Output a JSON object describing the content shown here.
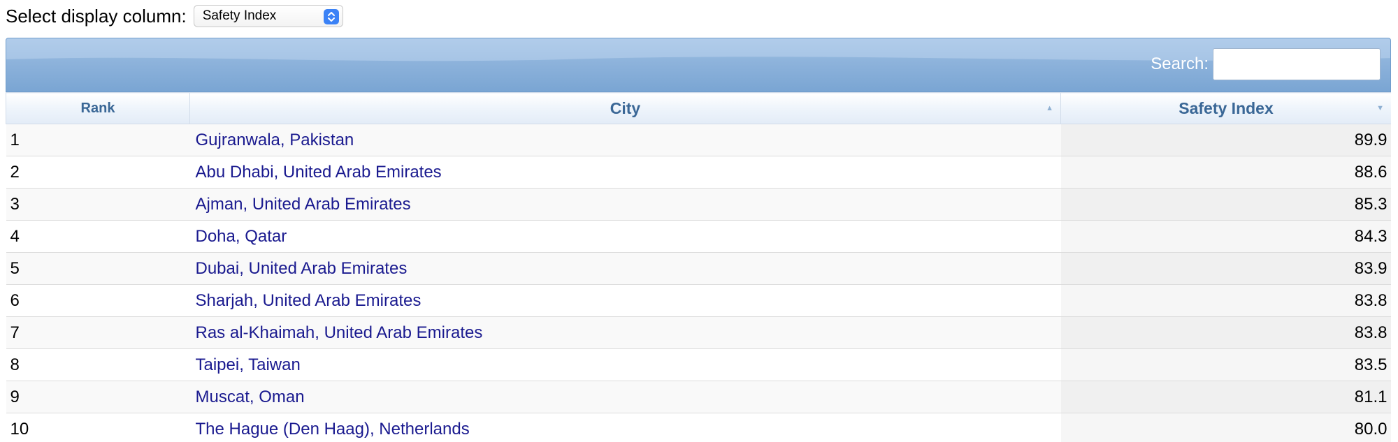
{
  "selector": {
    "label": "Select display column:",
    "selected": "Safety Index"
  },
  "search": {
    "label": "Search:",
    "value": ""
  },
  "table": {
    "headers": {
      "rank": "Rank",
      "city": "City",
      "value": "Safety Index"
    },
    "rows": [
      {
        "rank": "1",
        "city": "Gujranwala, Pakistan",
        "value": "89.9"
      },
      {
        "rank": "2",
        "city": "Abu Dhabi, United Arab Emirates",
        "value": "88.6"
      },
      {
        "rank": "3",
        "city": "Ajman, United Arab Emirates",
        "value": "85.3"
      },
      {
        "rank": "4",
        "city": "Doha, Qatar",
        "value": "84.3"
      },
      {
        "rank": "5",
        "city": "Dubai, United Arab Emirates",
        "value": "83.9"
      },
      {
        "rank": "6",
        "city": "Sharjah, United Arab Emirates",
        "value": "83.8"
      },
      {
        "rank": "7",
        "city": "Ras al-Khaimah, United Arab Emirates",
        "value": "83.8"
      },
      {
        "rank": "8",
        "city": "Taipei, Taiwan",
        "value": "83.5"
      },
      {
        "rank": "9",
        "city": "Muscat, Oman",
        "value": "81.1"
      },
      {
        "rank": "10",
        "city": "The Hague (Den Haag), Netherlands",
        "value": "80.0"
      }
    ]
  },
  "colors": {
    "toolbar": "#8fb4dc",
    "header_text": "#3a6796",
    "link": "#1a1a8f",
    "select_accent": "#3b82f6"
  }
}
